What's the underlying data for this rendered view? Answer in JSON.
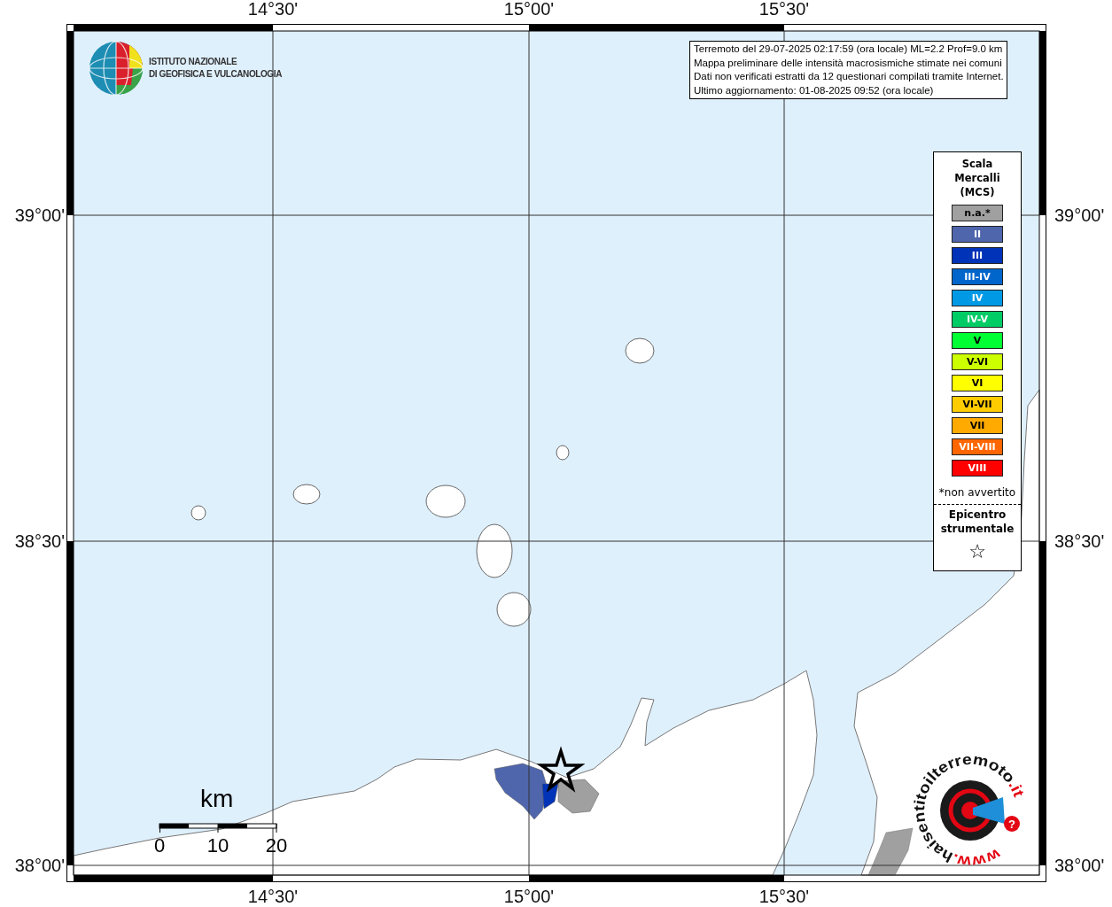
{
  "map": {
    "axis_labels": {
      "top": [
        "14°30'",
        "15°00'",
        "15°30'"
      ],
      "bottom": [
        "14°30'",
        "15°00'",
        "15°30'"
      ],
      "left": [
        "39°00'",
        "38°30'",
        "38°00'"
      ],
      "right": [
        "39°00'",
        "38°30'",
        "38°00'"
      ]
    },
    "logo": {
      "lines": [
        "ISTITUTO NAZIONALE",
        "DI GEOFISICA E VULCANOLOGIA"
      ]
    },
    "info_box": {
      "lines": [
        "Terremoto del 29-07-2025 02:17:59 (ora locale) ML=2.2 Prof=9.0 km",
        "Mappa preliminare delle intensità macrosismiche stimate nei comuni",
        "Dati non verificati estratti da 12 questionari compilati tramite Internet.",
        "Ultimo aggiornamento: 01-08-2025 09:52 (ora locale)"
      ]
    },
    "legend": {
      "title_lines": [
        "Scala",
        "Mercalli",
        "(MCS)"
      ],
      "items": [
        {
          "label": "n.a.*",
          "color": "#a0a0a0"
        },
        {
          "label": "II",
          "color": "#4f66ad"
        },
        {
          "label": "III",
          "color": "#0033b8"
        },
        {
          "label": "III-IV",
          "color": "#0066cc"
        },
        {
          "label": "IV",
          "color": "#0099e6"
        },
        {
          "label": "IV-V",
          "color": "#00cc66"
        },
        {
          "label": "V",
          "color": "#00ff33"
        },
        {
          "label": "V-VI",
          "color": "#ccff00"
        },
        {
          "label": "VI",
          "color": "#ffff00"
        },
        {
          "label": "VI-VII",
          "color": "#ffcc00"
        },
        {
          "label": "VII",
          "color": "#ffaa00"
        },
        {
          "label": "VII-VIII",
          "color": "#ff6600"
        },
        {
          "label": "VIII",
          "color": "#ff0000"
        }
      ],
      "footnote": "*non avvertito",
      "epicentre_lines": [
        "Epicentro",
        "strumentale"
      ],
      "epicentre_symbol": "☆"
    },
    "scale_bar": {
      "unit": "km",
      "ticks": [
        "0",
        "10",
        "20"
      ]
    },
    "badge": {
      "prefix": "www.",
      "name": "haisentitoilterremoto",
      "suffix": ".it",
      "mark": "?"
    }
  }
}
